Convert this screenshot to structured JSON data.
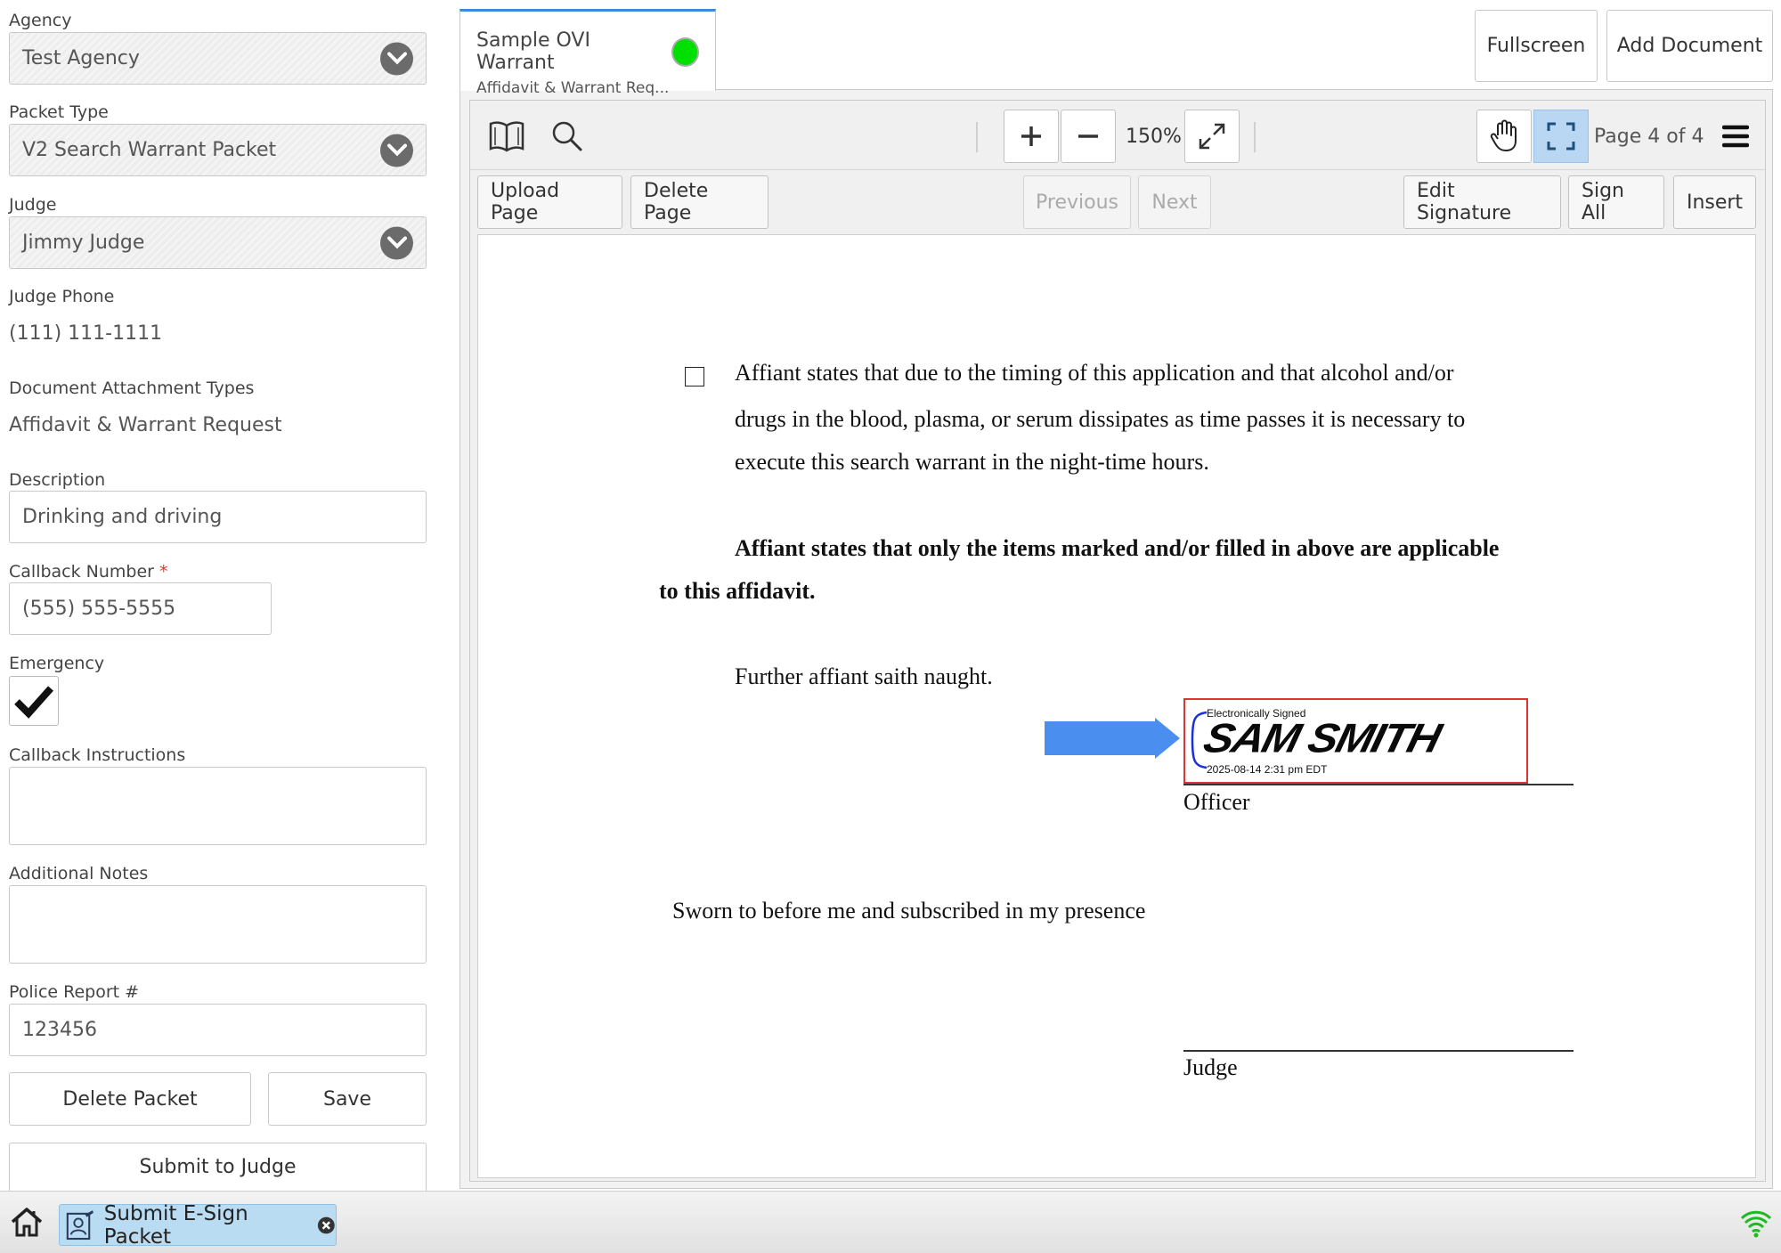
{
  "form": {
    "agency_label": "Agency",
    "agency_value": "Test Agency",
    "packet_type_label": "Packet Type",
    "packet_type_value": "V2 Search Warrant Packet",
    "judge_label": "Judge",
    "judge_value": "Jimmy Judge",
    "judge_phone_label": "Judge Phone",
    "judge_phone_value": "(111) 111-1111",
    "doc_types_label": "Document Attachment Types",
    "doc_types_value": "Affidavit & Warrant Request",
    "description_label": "Description",
    "description_value": "Drinking and driving",
    "callback_label": "Callback Number",
    "callback_required": "*",
    "callback_value": "(555) 555-5555",
    "emergency_label": "Emergency",
    "emergency_checked": true,
    "callback_instructions_label": "Callback Instructions",
    "callback_instructions_value": "",
    "notes_label": "Additional Notes",
    "notes_value": "",
    "police_report_label": "Police Report #",
    "police_report_value": "123456",
    "delete_packet": "Delete Packet",
    "save": "Save",
    "submit_to_judge": "Submit to Judge"
  },
  "doc_tab": {
    "title": "Sample OVI Warrant",
    "subtitle": "Affidavit & Warrant Req...",
    "status_color": "#00e000"
  },
  "top_buttons": {
    "fullscreen": "Fullscreen",
    "add_document": "Add Document"
  },
  "viewer": {
    "zoom": "150%",
    "page_indicator": "Page 4 of 4",
    "upload_page": "Upload Page",
    "delete_page": "Delete Page",
    "previous": "Previous",
    "next": "Next",
    "edit_signature": "Edit Signature",
    "sign_all": "Sign All",
    "insert": "Insert"
  },
  "document": {
    "para1_line1": "Affiant states that due to the timing of this application and that alcohol and/or",
    "para1_line2": "drugs in the blood, plasma, or serum dissipates as time passes it is necessary to",
    "para1_line3": "execute this search warrant in the night-time hours.",
    "para2_line1": "Affiant states that only the items marked and/or filled in above are applicable",
    "para2_line2": "to this affidavit.",
    "para3": "Further affiant saith naught.",
    "sig_header": "Electronically Signed",
    "sig_name": "SAM SMITH",
    "sig_timestamp": "2025-08-14 2:31 pm EDT",
    "officer_label": "Officer",
    "sworn_text": "Sworn to before me and subscribed in my presence",
    "judge_label": "Judge"
  },
  "taskbar": {
    "task_label": "Submit E-Sign Packet"
  },
  "colors": {
    "accent": "#3a8be0",
    "arrow": "#4a8ff0",
    "status_green": "#00e000",
    "active_tool": "#b9d7f2"
  }
}
